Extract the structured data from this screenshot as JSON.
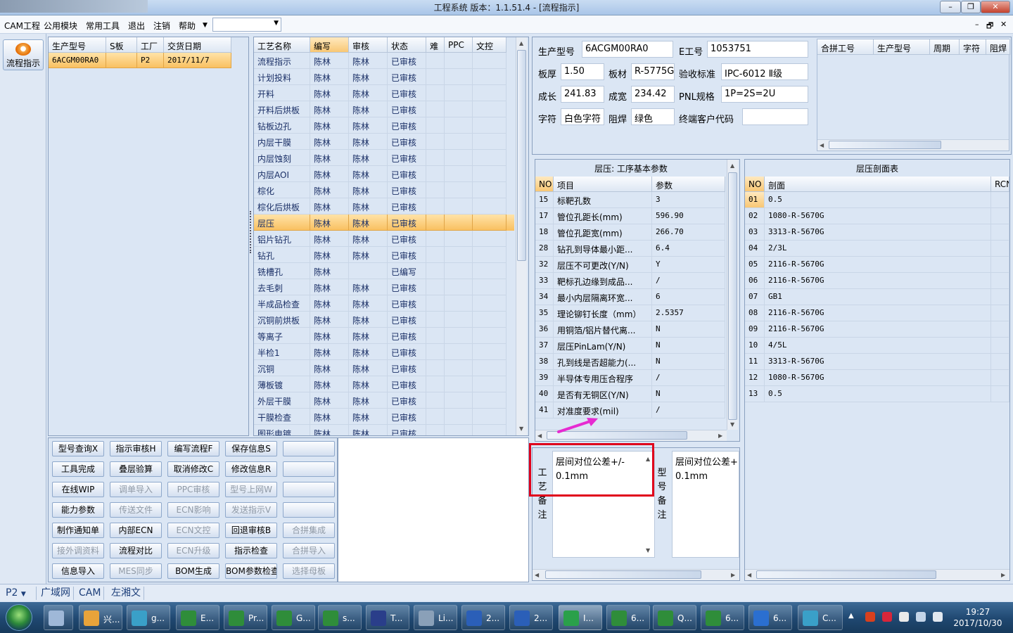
{
  "window": {
    "title": "工程系统    版本：1.1.51.4 - [流程指示]",
    "controls": {
      "minimize": "–",
      "restore": "❐",
      "close": "✕"
    }
  },
  "menu": {
    "items": [
      "CAM工程",
      "公用模块",
      "常用工具",
      "退出",
      "注销",
      "帮助"
    ],
    "combo_value": "",
    "mdi_controls": {
      "minimize": "–",
      "restore": "🗗",
      "close": "✕"
    }
  },
  "launcher": {
    "flow_button": "流程指示"
  },
  "jobs": {
    "headers": [
      "生产型号",
      "S板",
      "工厂",
      "交货日期"
    ],
    "rows": [
      [
        "6ACGM00RA0",
        "",
        "P2",
        "2017/11/7"
      ]
    ]
  },
  "process": {
    "headers": [
      "工艺名称",
      "编写",
      "审核",
      "状态",
      "难",
      "PPC",
      "文控"
    ],
    "selected_index": 10,
    "rows": [
      [
        "流程指示",
        "陈林",
        "陈林",
        "已审核"
      ],
      [
        "计划投料",
        "陈林",
        "陈林",
        "已审核"
      ],
      [
        "开料",
        "陈林",
        "陈林",
        "已审核"
      ],
      [
        "开料后烘板",
        "陈林",
        "陈林",
        "已审核"
      ],
      [
        "钻板边孔",
        "陈林",
        "陈林",
        "已审核"
      ],
      [
        "内层干膜",
        "陈林",
        "陈林",
        "已审核"
      ],
      [
        "内层蚀刻",
        "陈林",
        "陈林",
        "已审核"
      ],
      [
        "内层AOI",
        "陈林",
        "陈林",
        "已审核"
      ],
      [
        "棕化",
        "陈林",
        "陈林",
        "已审核"
      ],
      [
        "棕化后烘板",
        "陈林",
        "陈林",
        "已审核"
      ],
      [
        "层压",
        "陈林",
        "陈林",
        "已审核"
      ],
      [
        "铝片钻孔",
        "陈林",
        "陈林",
        "已审核"
      ],
      [
        "钻孔",
        "陈林",
        "陈林",
        "已审核"
      ],
      [
        "铣槽孔",
        "陈林",
        "",
        "已编写"
      ],
      [
        "去毛刺",
        "陈林",
        "陈林",
        "已审核"
      ],
      [
        "半成品检查",
        "陈林",
        "陈林",
        "已审核"
      ],
      [
        "沉铜前烘板",
        "陈林",
        "陈林",
        "已审核"
      ],
      [
        "等离子",
        "陈林",
        "陈林",
        "已审核"
      ],
      [
        "半检1",
        "陈林",
        "陈林",
        "已审核"
      ],
      [
        "沉铜",
        "陈林",
        "陈林",
        "已审核"
      ],
      [
        "薄板镀",
        "陈林",
        "陈林",
        "已审核"
      ],
      [
        "外层干膜",
        "陈林",
        "陈林",
        "已审核"
      ],
      [
        "干膜检查",
        "陈林",
        "陈林",
        "已审核"
      ],
      [
        "图形电镀",
        "陈林",
        "陈林",
        "已审核"
      ]
    ]
  },
  "buttons": [
    [
      {
        "label": "型号查询X",
        "enabled": true
      },
      {
        "label": "指示审核H",
        "enabled": true
      },
      {
        "label": "编写流程F",
        "enabled": true
      },
      {
        "label": "保存信息S",
        "enabled": true
      },
      {
        "label": "",
        "enabled": true
      }
    ],
    [
      {
        "label": "工具完成",
        "enabled": true
      },
      {
        "label": "叠层验算",
        "enabled": true
      },
      {
        "label": "取消修改C",
        "enabled": true
      },
      {
        "label": "修改信息R",
        "enabled": true
      },
      {
        "label": "",
        "enabled": true
      }
    ],
    [
      {
        "label": "在线WIP",
        "enabled": true
      },
      {
        "label": "调单导入",
        "enabled": false
      },
      {
        "label": "PPC审核",
        "enabled": false
      },
      {
        "label": "型号上网W",
        "enabled": false
      },
      {
        "label": "",
        "enabled": true
      }
    ],
    [
      {
        "label": "能力参数",
        "enabled": true
      },
      {
        "label": "传送文件",
        "enabled": false
      },
      {
        "label": "ECN影响",
        "enabled": false
      },
      {
        "label": "发送指示V",
        "enabled": false
      },
      {
        "label": "",
        "enabled": true
      }
    ],
    [
      {
        "label": "制作通知单",
        "enabled": true
      },
      {
        "label": "内部ECN",
        "enabled": true
      },
      {
        "label": "ECN文控",
        "enabled": false
      },
      {
        "label": "回退审核B",
        "enabled": true
      },
      {
        "label": "合拼集成",
        "enabled": false
      }
    ],
    [
      {
        "label": "接外调资料",
        "enabled": false
      },
      {
        "label": "流程对比",
        "enabled": true
      },
      {
        "label": "ECN升级",
        "enabled": false
      },
      {
        "label": "指示检查",
        "enabled": true
      },
      {
        "label": "合拼导入",
        "enabled": false
      }
    ],
    [
      {
        "label": "信息导入",
        "enabled": true
      },
      {
        "label": "MES同步",
        "enabled": false
      },
      {
        "label": "BOM生成",
        "enabled": true
      },
      {
        "label": "BOM参数检查",
        "enabled": true
      },
      {
        "label": "选择母板",
        "enabled": false
      }
    ]
  ],
  "info": {
    "prod_model_label": "生产型号",
    "prod_model": "6ACGM00RA0",
    "e_no_label": "E工号",
    "e_no": "1053751",
    "thickness_label": "板厚",
    "thickness": "1.50",
    "material_label": "板材",
    "material": "R-5775G",
    "standard_label": "验收标准",
    "standard": "IPC-6012 Ⅱ级",
    "length_label": "成长",
    "length": "241.83",
    "width_label": "成宽",
    "width": "234.42",
    "pnl_label": "PNL规格",
    "pnl": "1P=2S=2U",
    "char_label": "字符",
    "char": "白色字符",
    "mask_label": "阻焊",
    "mask": "绿色",
    "customer_label": "终端客户代码",
    "customer": "",
    "merge_headers": [
      "合拼工号",
      "生产型号",
      "周期",
      "字符",
      "阻焊"
    ]
  },
  "params": {
    "title": "层压: 工序基本参数",
    "headers": [
      "NO",
      "项目",
      "参数"
    ],
    "rows": [
      [
        "15",
        "标靶孔数",
        "3"
      ],
      [
        "17",
        "管位孔距长(mm)",
        "596.90"
      ],
      [
        "18",
        "管位孔距宽(mm)",
        "266.70"
      ],
      [
        "28",
        "钻孔到导体最小距...",
        "6.4"
      ],
      [
        "32",
        "层压不可更改(Y/N)",
        "Y"
      ],
      [
        "33",
        "靶标孔边缘到成品...",
        "/"
      ],
      [
        "34",
        "最小内层隔离环宽...",
        "6"
      ],
      [
        "35",
        "理论铆钉长度（mm）",
        "2.5357"
      ],
      [
        "36",
        "用铜箔/铝片替代离...",
        "N"
      ],
      [
        "37",
        "层压PinLam(Y/N)",
        "N"
      ],
      [
        "38",
        "孔到线是否超能力(...",
        "N"
      ],
      [
        "39",
        "半导体专用压合程序",
        "/"
      ],
      [
        "40",
        "是否有无铜区(Y/N)",
        "N"
      ],
      [
        "41",
        "对准度要求(mil)",
        "/"
      ]
    ]
  },
  "stackup": {
    "title": "层压剖面表",
    "headers": [
      "NO",
      "剖面",
      "RCN"
    ],
    "rows": [
      [
        "01",
        "0.5"
      ],
      [
        "02",
        "1080-R-5670G"
      ],
      [
        "03",
        "3313-R-5670G"
      ],
      [
        "04",
        "2/3L"
      ],
      [
        "05",
        "2116-R-5670G"
      ],
      [
        "06",
        "2116-R-5670G"
      ],
      [
        "07",
        "GB1"
      ],
      [
        "08",
        "2116-R-5670G"
      ],
      [
        "09",
        "2116-R-5670G"
      ],
      [
        "10",
        "4/5L"
      ],
      [
        "11",
        "3313-R-5670G"
      ],
      [
        "12",
        "1080-R-5670G"
      ],
      [
        "13",
        "0.5"
      ]
    ]
  },
  "remarks": {
    "process_label": "工艺备注",
    "process_text": "层间对位公差+/-\n0.1mm",
    "model_label": "型号备注",
    "model_text": "层间对位公差+\n0.1mm"
  },
  "status": {
    "plant": "P2",
    "tabs": [
      "广域网",
      "CAM",
      "左湘文"
    ]
  },
  "taskbar": {
    "items": [
      "兴...",
      "g...",
      "E...",
      "Pr...",
      "G...",
      "s...",
      "T...",
      "Li...",
      "2...",
      "2...",
      "I...",
      "6...",
      "Q...",
      "6...",
      "6...",
      "C..."
    ],
    "time": "19:27",
    "date": "2017/10/30"
  },
  "colors": {
    "highlight_box": "#e0001b",
    "arrow": "#e62ad1",
    "selection": "#f9bf5e"
  }
}
